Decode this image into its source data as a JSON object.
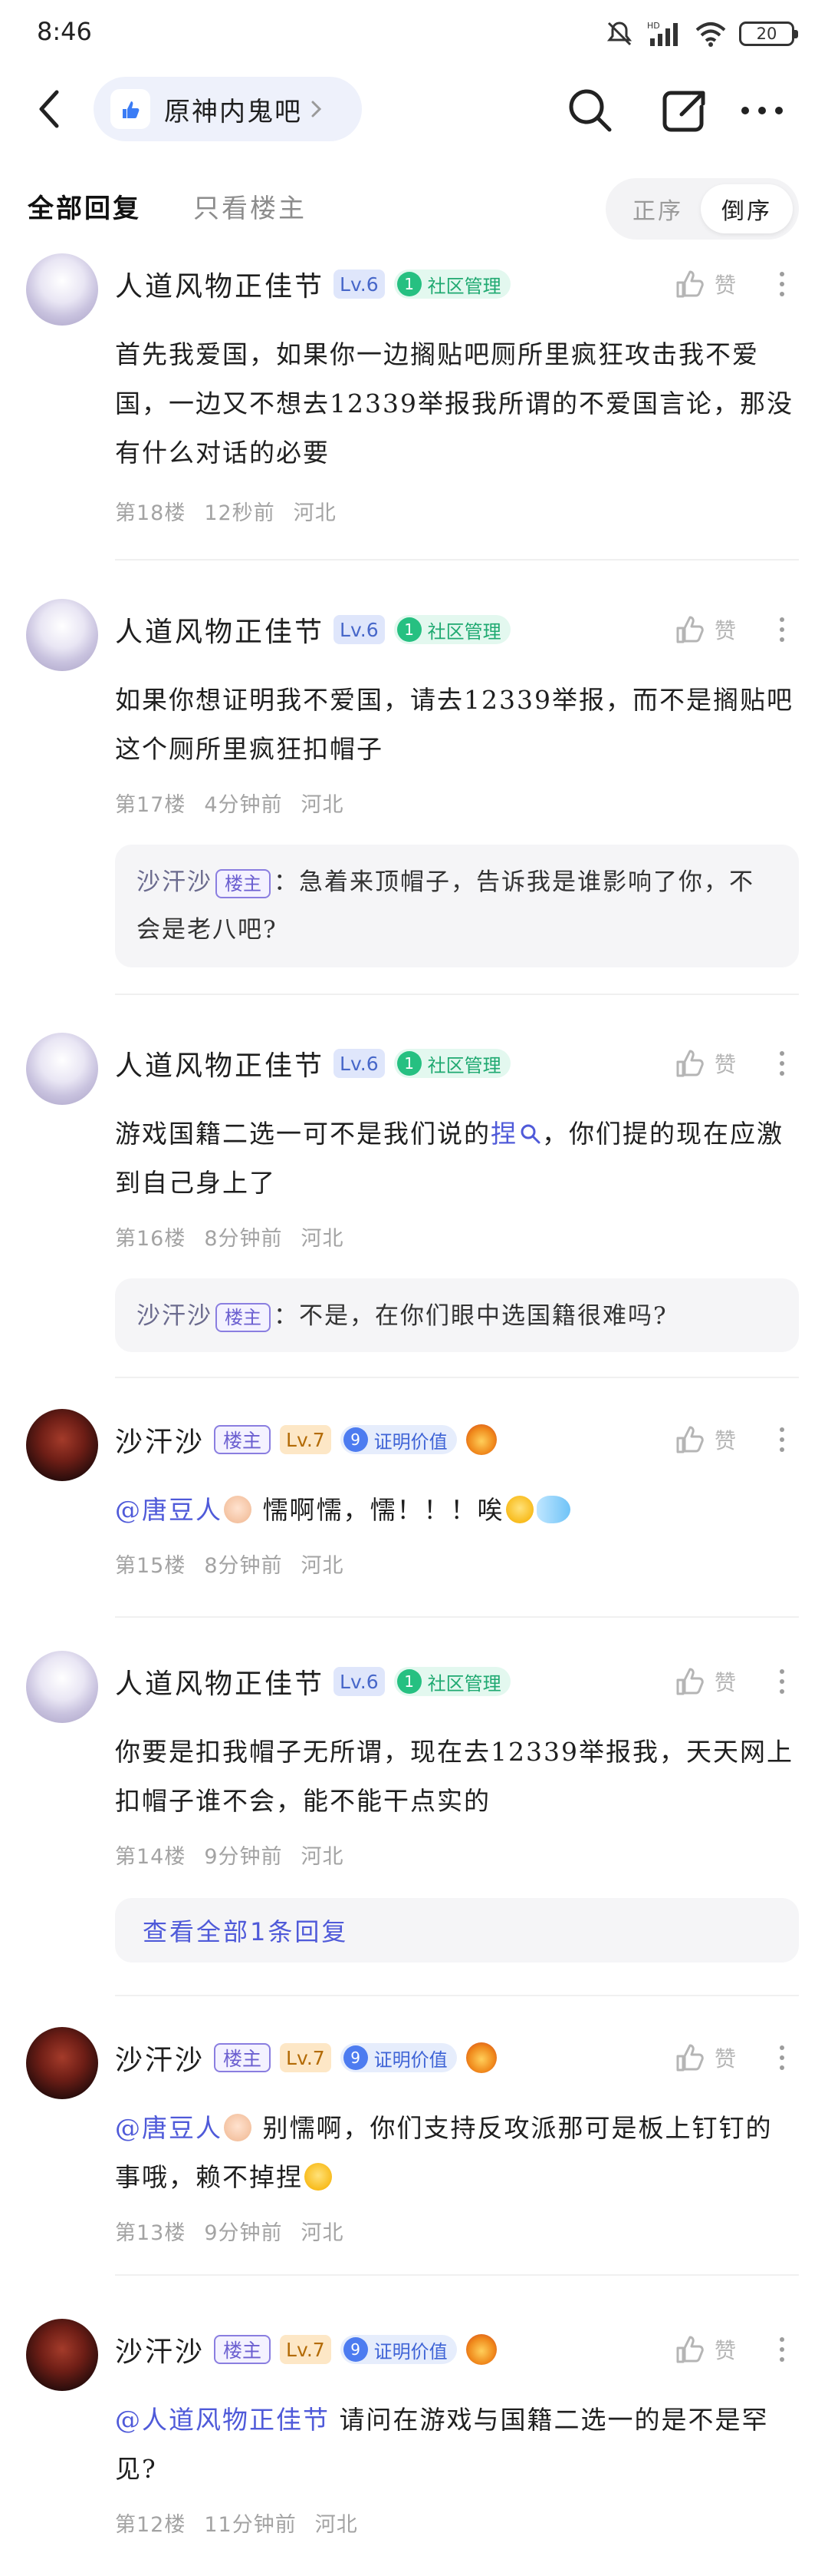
{
  "status_bar": {
    "time": "8:46",
    "battery": "20"
  },
  "nav": {
    "forum_name": "原神内鬼吧"
  },
  "tabs": {
    "all": "全部回复",
    "owner_only": "只看楼主",
    "sort_asc": "正序",
    "sort_desc": "倒序"
  },
  "like_label": "赞",
  "posts": [
    {
      "author": "人道风物正佳节",
      "level": "Lv.6",
      "tag_num": "1",
      "tag": "社区管理",
      "text": "首先我爱国，如果你一边搁贴吧厕所里疯狂攻击我不爱国，一边又不想去12339举报我所谓的不爱国言论，那没有什么对话的必要",
      "floor": "第18楼",
      "time": "12秒前",
      "location": "河北"
    },
    {
      "author": "人道风物正佳节",
      "level": "Lv.6",
      "tag_num": "1",
      "tag": "社区管理",
      "text": "如果你想证明我不爱国，请去12339举报，而不是搁贴吧这个厕所里疯狂扣帽子",
      "floor": "第17楼",
      "time": "4分钟前",
      "location": "河北",
      "quote": {
        "name": "沙汗沙",
        "badge": "楼主",
        "text": "：急着来顶帽子，告诉我是谁影响了你，不会是老八吧?"
      }
    },
    {
      "author": "人道风物正佳节",
      "level": "Lv.6",
      "tag_num": "1",
      "tag": "社区管理",
      "text_before": "游戏国籍二选一可不是我们说的",
      "text_link": "捏",
      "text_after": "，你们提的现在应激到自己身上了",
      "floor": "第16楼",
      "time": "8分钟前",
      "location": "河北",
      "quote": {
        "name": "沙汗沙",
        "badge": "楼主",
        "text": "：不是，在你们眼中选国籍很难吗?"
      }
    },
    {
      "author": "沙汗沙",
      "owner_badge": "楼主",
      "level": "Lv.7",
      "tag_num": "9",
      "tag": "证明价值",
      "mention": "@唐豆人",
      "text": " 懦啊懦，懦！！！唉",
      "floor": "第15楼",
      "time": "8分钟前",
      "location": "河北"
    },
    {
      "author": "人道风物正佳节",
      "level": "Lv.6",
      "tag_num": "1",
      "tag": "社区管理",
      "text": "你要是扣我帽子无所谓，现在去12339举报我，天天网上扣帽子谁不会，能不能干点实的",
      "floor": "第14楼",
      "time": "9分钟前",
      "location": "河北",
      "view_all": "查看全部1条回复"
    },
    {
      "author": "沙汗沙",
      "owner_badge": "楼主",
      "level": "Lv.7",
      "tag_num": "9",
      "tag": "证明价值",
      "mention": "@唐豆人",
      "text": " 别懦啊，你们支持反攻派那可是板上钉钉的事哦，赖不掉捏",
      "floor": "第13楼",
      "time": "9分钟前",
      "location": "河北"
    },
    {
      "author": "沙汗沙",
      "owner_badge": "楼主",
      "level": "Lv.7",
      "tag_num": "9",
      "tag": "证明价值",
      "mention": "@人道风物正佳节",
      "text": " 请问在游戏与国籍二选一的是不是罕见?",
      "floor": "第12楼",
      "time": "11分钟前",
      "location": "河北"
    }
  ]
}
